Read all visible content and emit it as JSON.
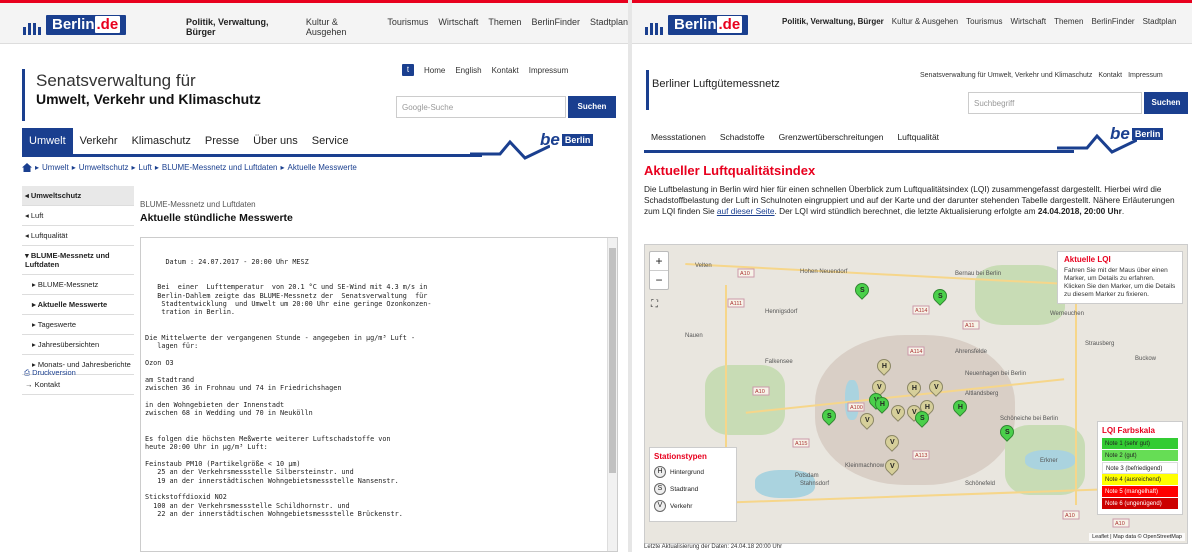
{
  "left": {
    "topnav": [
      "Politik, Verwaltung, Bürger",
      "Kultur & Ausgehen",
      "Tourismus",
      "Wirtschaft",
      "Themen",
      "BerlinFinder",
      "Stadtplan"
    ],
    "logo": {
      "prefix": "Berlin",
      "suffix": ".de"
    },
    "header": {
      "line1": "Senatsverwaltung für",
      "line2": "Umwelt, Verkehr und Klimaschutz"
    },
    "util": [
      "Home",
      "English",
      "Kontakt",
      "Impressum"
    ],
    "search": {
      "placeholder": "Google-Suche",
      "button": "Suchen"
    },
    "mainnav": [
      "Umwelt",
      "Verkehr",
      "Klimaschutz",
      "Presse",
      "Über uns",
      "Service"
    ],
    "be_berlin": {
      "be": "be",
      "berlin": "Berlin"
    },
    "breadcrumb": [
      "Umwelt",
      "Umweltschutz",
      "Luft",
      "BLUME-Messnetz und Luftdaten",
      "Aktuelle Messwerte"
    ],
    "sidebar": [
      "Umweltschutz",
      "Luft",
      "Luftqualität",
      "BLUME-Messnetz und Luftdaten",
      "BLUME-Messnetz",
      "Aktuelle Messwerte",
      "Tageswerte",
      "Jahresübersichten",
      "Monats- und Jahresberichte",
      "Kontakt"
    ],
    "print": "Druckversion",
    "content_sub": "BLUME-Messnetz und Luftdaten",
    "content_title": "Aktuelle stündliche Messwerte",
    "report": "     Datum : 24.07.2017 - 20:00 Uhr MESZ\n\n\n   Bei  einer  Lufttemperatur  von 20.1 °C und SE-Wind mit 4.3 m/s in\n   Berlin-Dahlem zeigte das BLUME-Messnetz der  Senatsverwaltung  für\n    Stadtentwicklung  und Umwelt um 20:00 Uhr eine geringe Ozonkonzen-\n    tration in Berlin.\n\n\nDie Mittelwerte der vergangenen Stunde - angegeben in µg/m³ Luft -\n   lagen für:\n\nOzon O3\n\nam Stadtrand\nzwischen 36 in Frohnau und 74 in Friedrichshagen\n\nin den Wohngebieten der Innenstadt\nzwischen 68 in Wedding und 70 in Neukölln\n\n\nEs folgen die höchsten Meßwerte weiterer Luftschadstoffe von\nheute 20:00 Uhr in µg/m³ Luft:\n\nFeinstaub PM10 (Partikelgröße < 10 µm)\n   25 an der Verkehrsmessstelle Silbersteinstr. und\n   19 an der innerstädtischen Wohngebietsmessstelle Nansenstr.\n\nStickstoffdioxid NO2\n  100 an der Verkehrsmessstelle Schildhornstr. und\n   22 an der innerstädtischen Wohngebietsmessstelle Brückenstr."
  },
  "right": {
    "topnav": [
      "Politik, Verwaltung, Bürger",
      "Kultur & Ausgehen",
      "Tourismus",
      "Wirtschaft",
      "Themen",
      "BerlinFinder",
      "Stadtplan"
    ],
    "logo": {
      "prefix": "Berlin",
      "suffix": ".de"
    },
    "title": "Berliner Luftgütemessnetz",
    "util": [
      "Senatsverwaltung für Umwelt, Verkehr und Klimaschutz",
      "Kontakt",
      "Impressum"
    ],
    "search": {
      "placeholder": "Suchbegriff",
      "button": "Suchen"
    },
    "mainnav": [
      "Messstationen",
      "Schadstoffe",
      "Grenzwertüberschreitungen",
      "Luftqualität"
    ],
    "be_berlin": {
      "be": "be",
      "berlin": "Berlin"
    },
    "heading": "Aktueller Luftqualitätsindex",
    "para_a": "Die Luftbelastung in Berlin wird hier für einen schnellen Überblick zum Luftqualitätsindex (LQI) zusammengefasst dargestellt. Hierbei wird die Schadstoffbelastung der Luft in Schulnoten eingruppiert und auf der Karte und der darunter stehenden Tabelle dargestellt. Nähere Erläuterungen zum LQI finden Sie ",
    "para_link": "auf dieser Seite",
    "para_b": ". Der LQI wird stündlich berechnet, die letzte Aktualisierung erfolgte am ",
    "para_date": "24.04.2018, 20:00 Uhr",
    "para_end": ".",
    "map": {
      "zoom_in": "+",
      "zoom_out": "−",
      "info_title": "Aktuelle LQI",
      "info_text": "Fahren Sie mit der Maus über einen Marker, um Details zu erfahren. Klicken Sie den Marker, um die Details zu diesem Marker zu fixieren.",
      "legend_title": "Stationstypen",
      "legend": [
        {
          "letter": "H",
          "label": "Hintergrund"
        },
        {
          "letter": "S",
          "label": "Stadtrand"
        },
        {
          "letter": "V",
          "label": "Verkehr"
        }
      ],
      "scale_title": "LQI Farbskala",
      "scale": [
        {
          "label": "Note 1 (sehr gut)",
          "color": "#33cc33",
          "text": "#222"
        },
        {
          "label": "Note 2 (gut)",
          "color": "#66dd55",
          "text": "#222"
        },
        {
          "label": "Note 3 (befriedigend)",
          "color": "#ffffff",
          "text": "#222"
        },
        {
          "label": "Note 4 (ausreichend)",
          "color": "#ffff00",
          "text": "#222"
        },
        {
          "label": "Note 5 (mangelhaft)",
          "color": "#ff0000",
          "text": "#fff"
        },
        {
          "label": "Note 6 (ungenügend)",
          "color": "#cc0000",
          "text": "#fff"
        }
      ],
      "places": [
        "Velten",
        "Hohen Neuendorf",
        "Bernau bei Berlin",
        "Hennigsdorf",
        "Werneuchen",
        "Nauen",
        "Falkensee",
        "Ahrensfelde",
        "Strausberg",
        "Altlandsberg",
        "Buckow",
        "Neuenhagen bei Berlin",
        "Potsdam",
        "Kleinmachnow",
        "Stahnsdorf",
        "Schöneiche bei Berlin",
        "Erkner",
        "Schönefeld"
      ],
      "roads": [
        "A10",
        "A111",
        "A114",
        "A11",
        "A114",
        "A10",
        "A100",
        "A115",
        "A113",
        "A10",
        "A10"
      ],
      "markers": [
        {
          "l": "S",
          "c": "g"
        },
        {
          "l": "S",
          "c": "g"
        },
        {
          "l": "H",
          "c": "y"
        },
        {
          "l": "V",
          "c": "y"
        },
        {
          "l": "H",
          "c": "y"
        },
        {
          "l": "V",
          "c": "y"
        },
        {
          "l": "V",
          "c": "g"
        },
        {
          "l": "H",
          "c": "g"
        },
        {
          "l": "H",
          "c": "y"
        },
        {
          "l": "V",
          "c": "y"
        },
        {
          "l": "H",
          "c": "g"
        },
        {
          "l": "S",
          "c": "g"
        },
        {
          "l": "V",
          "c": "y"
        },
        {
          "l": "V",
          "c": "y"
        },
        {
          "l": "S",
          "c": "g"
        },
        {
          "l": "S",
          "c": "g"
        },
        {
          "l": "V",
          "c": "y"
        },
        {
          "l": "V",
          "c": "y"
        }
      ],
      "attribution": "Leaflet | Map data © OpenStreetMap",
      "footer": "Letzte Aktualisierung der Daten: 24.04.18 20:00 Uhr"
    }
  }
}
